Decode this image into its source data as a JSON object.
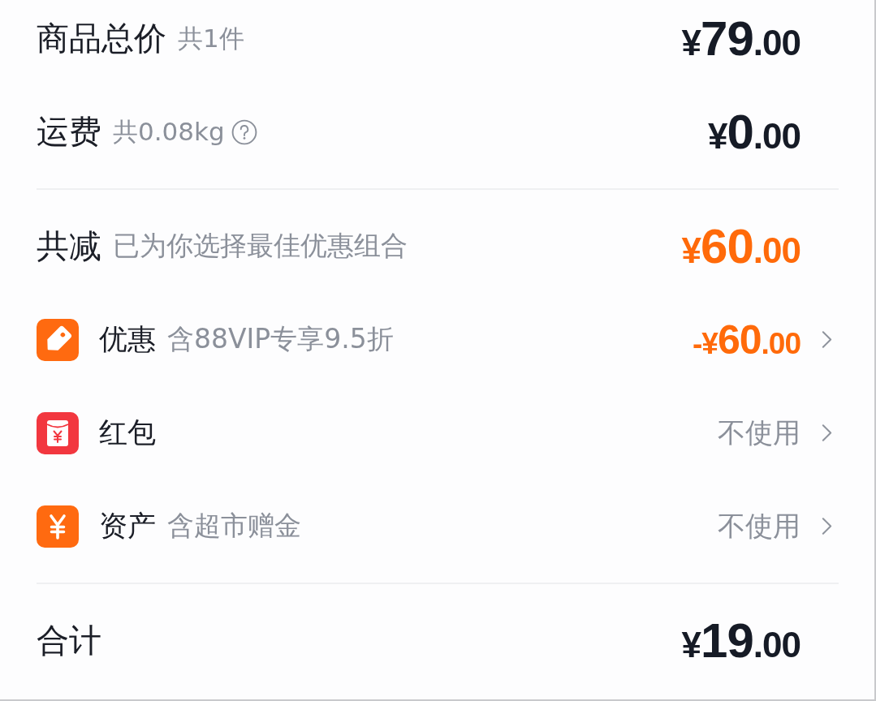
{
  "summary": [
    {
      "label": "商品总价",
      "note": "共1件",
      "help": false,
      "price": "¥79.00"
    },
    {
      "label": "运费",
      "note": "共0.08kg",
      "help": true,
      "price": "¥0.00"
    }
  ],
  "discount": {
    "label": "共减",
    "note": "已为你选择最佳优惠组合",
    "price": "¥60.00"
  },
  "benefits": [
    {
      "kind": "coupon",
      "label": "优惠",
      "note": "含88VIP专享9.5折",
      "value": {
        "kind": "amount",
        "text": "-¥60.00"
      }
    },
    {
      "kind": "red-packet",
      "label": "红包",
      "value": {
        "kind": "option",
        "text": "不使用"
      }
    },
    {
      "kind": "assets",
      "label": "资产",
      "note": "含超市赠金",
      "value": {
        "kind": "option",
        "text": "不使用"
      }
    }
  ],
  "total": {
    "label": "合计",
    "price": "¥19.00"
  }
}
